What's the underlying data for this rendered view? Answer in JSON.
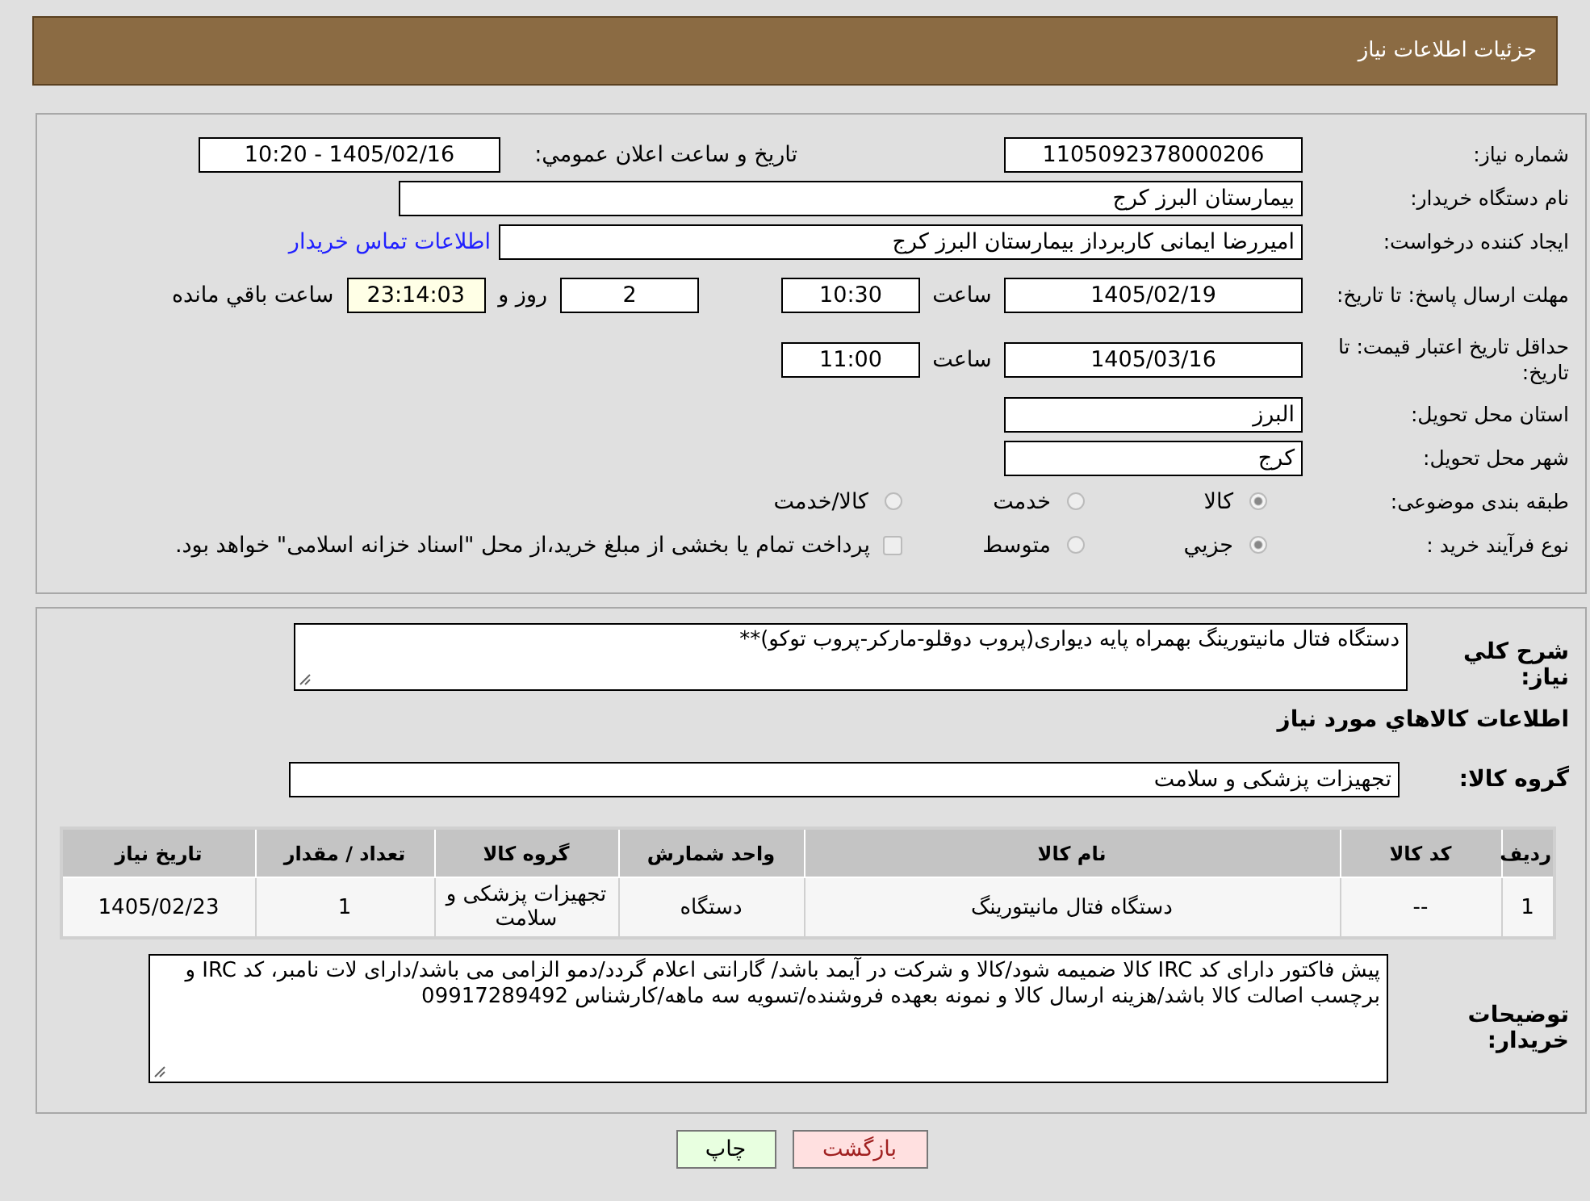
{
  "header": {
    "title": "جزئیات اطلاعات نیاز"
  },
  "need_number": {
    "label": "شماره نیاز:",
    "value": "1105092378000206"
  },
  "announce": {
    "label": "تاریخ و ساعت اعلان عمومي:",
    "value": "1405/02/16 - 10:20"
  },
  "buyer": {
    "label": "نام دستگاه خریدار:",
    "value": "بیمارستان البرز کرج"
  },
  "creator": {
    "label": "ایجاد کننده درخواست:",
    "value": "امیررضا ایمانی کاربرداز بیمارستان البرز کرج",
    "link": "اطلاعات تماس خریدار"
  },
  "deadline": {
    "label": "مهلت ارسال پاسخ: تا تاریخ:",
    "date": "1405/02/19",
    "time_label": "ساعت",
    "time": "10:30",
    "days": "2",
    "days_label": "روز و",
    "remaining": "23:14:03",
    "remaining_label": "ساعت باقي مانده"
  },
  "validity": {
    "label": "حداقل تاریخ اعتبار قیمت: تا تاریخ:",
    "date": "1405/03/16",
    "time_label": "ساعت",
    "time": "11:00"
  },
  "province": {
    "label": "استان محل تحویل:",
    "value": "البرز"
  },
  "city": {
    "label": "شهر محل تحویل:",
    "value": "کرج"
  },
  "category": {
    "label": "طبقه بندی موضوعی:",
    "options": [
      {
        "kind": "radio",
        "label": "کالا",
        "selected": true
      },
      {
        "kind": "radio",
        "label": "خدمت",
        "selected": false
      },
      {
        "kind": "radio",
        "label": "کالا/خدمت",
        "selected": false
      }
    ]
  },
  "process": {
    "label": "نوع فرآیند خرید :",
    "options": [
      {
        "kind": "radio",
        "label": "جزيي",
        "selected": true
      },
      {
        "kind": "radio",
        "label": "متوسط",
        "selected": false
      },
      {
        "kind": "checkbox",
        "label": "پرداخت تمام یا بخشی از مبلغ خرید،از محل \"اسناد خزانه اسلامی\" خواهد بود.",
        "selected": false
      }
    ]
  },
  "description": {
    "label": "شرح کلي نیاز:",
    "value": "دستگاه فتال مانیتورینگ بهمراه پایه دیواری(پروب دوقلو-مارکر-پروب توکو)**"
  },
  "goods_title": "اطلاعات کالاهاي مورد نیاز",
  "goods_group": {
    "label": "گروه کالا:",
    "value": "تجهیزات پزشکی و سلامت"
  },
  "table": {
    "columns": [
      "ردیف",
      "کد کالا",
      "نام کالا",
      "واحد شمارش",
      "گروه کالا",
      "تعداد / مقدار",
      "تاریخ نیاز"
    ],
    "rows": [
      [
        "1",
        "--",
        "دستگاه فتال مانیتورینگ",
        "دستگاه",
        "تجهیزات پزشکی و سلامت",
        "1",
        "1405/02/23"
      ]
    ]
  },
  "notes": {
    "label": "توضیحات خریدار:",
    "value": "پیش فاکتور دارای کد IRC کالا ضمیمه شود/کالا و شرکت در آیمد باشد/ گارانتی اعلام گردد/دمو الزامی می باشد/دارای لات نامبر، کد IRC و برچسب اصالت کالا باشد/هزینه ارسال کالا و نمونه بعهده فروشنده/تسویه سه ماهه/کارشناس 09917289492"
  },
  "buttons": [
    {
      "kind": "back",
      "label": "بازگشت"
    },
    {
      "kind": "print",
      "label": "چاپ"
    }
  ]
}
